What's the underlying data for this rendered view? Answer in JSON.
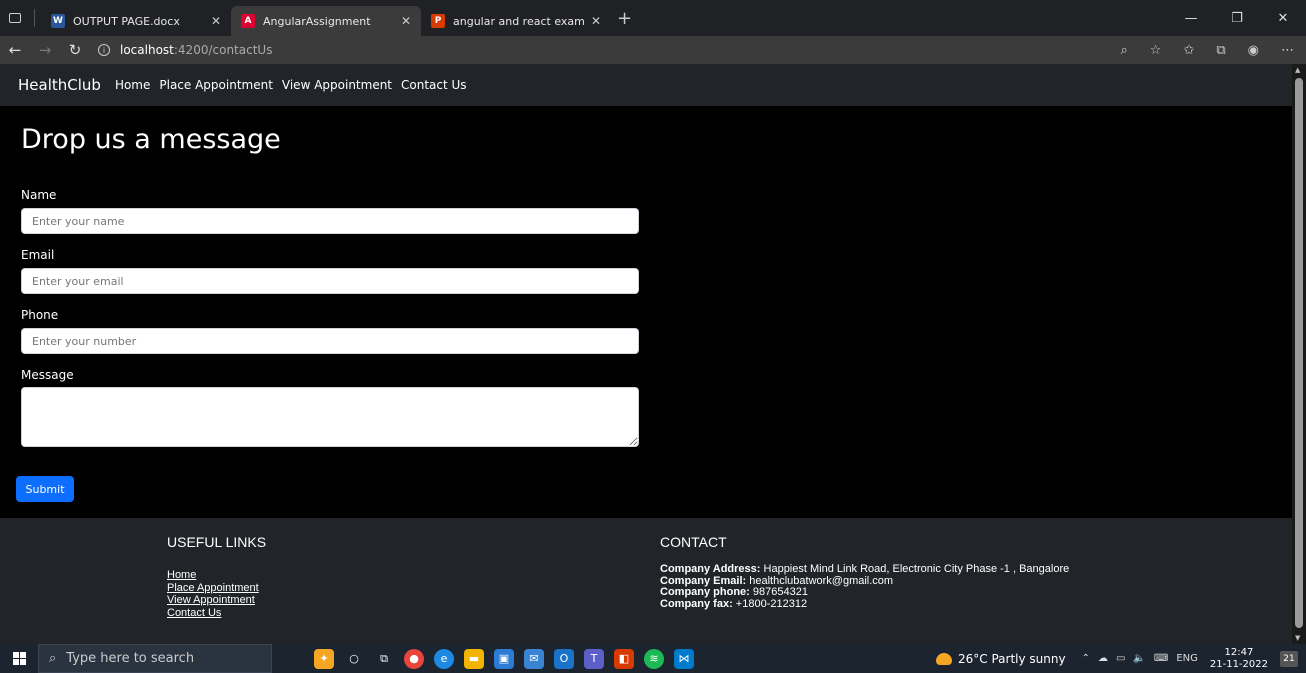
{
  "browser": {
    "tabs": [
      {
        "label": "OUTPUT PAGE.docx",
        "icon": "word-icon",
        "color": "#2b579a",
        "active": false
      },
      {
        "label": "AngularAssignment",
        "icon": "angular-icon",
        "color": "#dd0031",
        "active": true
      },
      {
        "label": "angular and react exam papers.p",
        "icon": "pdf-icon",
        "color": "#d83b01",
        "active": false
      }
    ],
    "url_host": "localhost",
    "url_path": ":4200/contactUs"
  },
  "navbar": {
    "brand": "HealthClub",
    "links": [
      "Home",
      "Place Appointment",
      "View Appointment",
      "Contact Us"
    ]
  },
  "form": {
    "title": "Drop us a message",
    "name_label": "Name",
    "name_placeholder": "Enter your name",
    "email_label": "Email",
    "email_placeholder": "Enter your email",
    "phone_label": "Phone",
    "phone_placeholder": "Enter your number",
    "message_label": "Message",
    "submit_label": "Submit"
  },
  "footer": {
    "links_title": "USEFUL LINKS",
    "links": [
      "Home",
      "Place Appointment",
      "View Appointment",
      "Contact Us"
    ],
    "contact_title": "CONTACT",
    "address_label": "Company Address:",
    "address_value": " Happiest Mind Link Road, Electronic City Phase -1 , Bangalore",
    "email_label": "Company Email:",
    "email_value": " healthclubatwork@gmail.com",
    "phone_label": "Company phone:",
    "phone_value": " 987654321",
    "fax_label": "Company fax:",
    "fax_value": " +1800-212312"
  },
  "taskbar": {
    "search_placeholder": "Type here to search",
    "weather": "26°C  Partly sunny",
    "language": "ENG",
    "time": "12:47",
    "date": "21-11-2022",
    "notifications": "21"
  },
  "colors": {
    "navbar_bg": "#212529",
    "submit_bg": "#0d6efd"
  }
}
